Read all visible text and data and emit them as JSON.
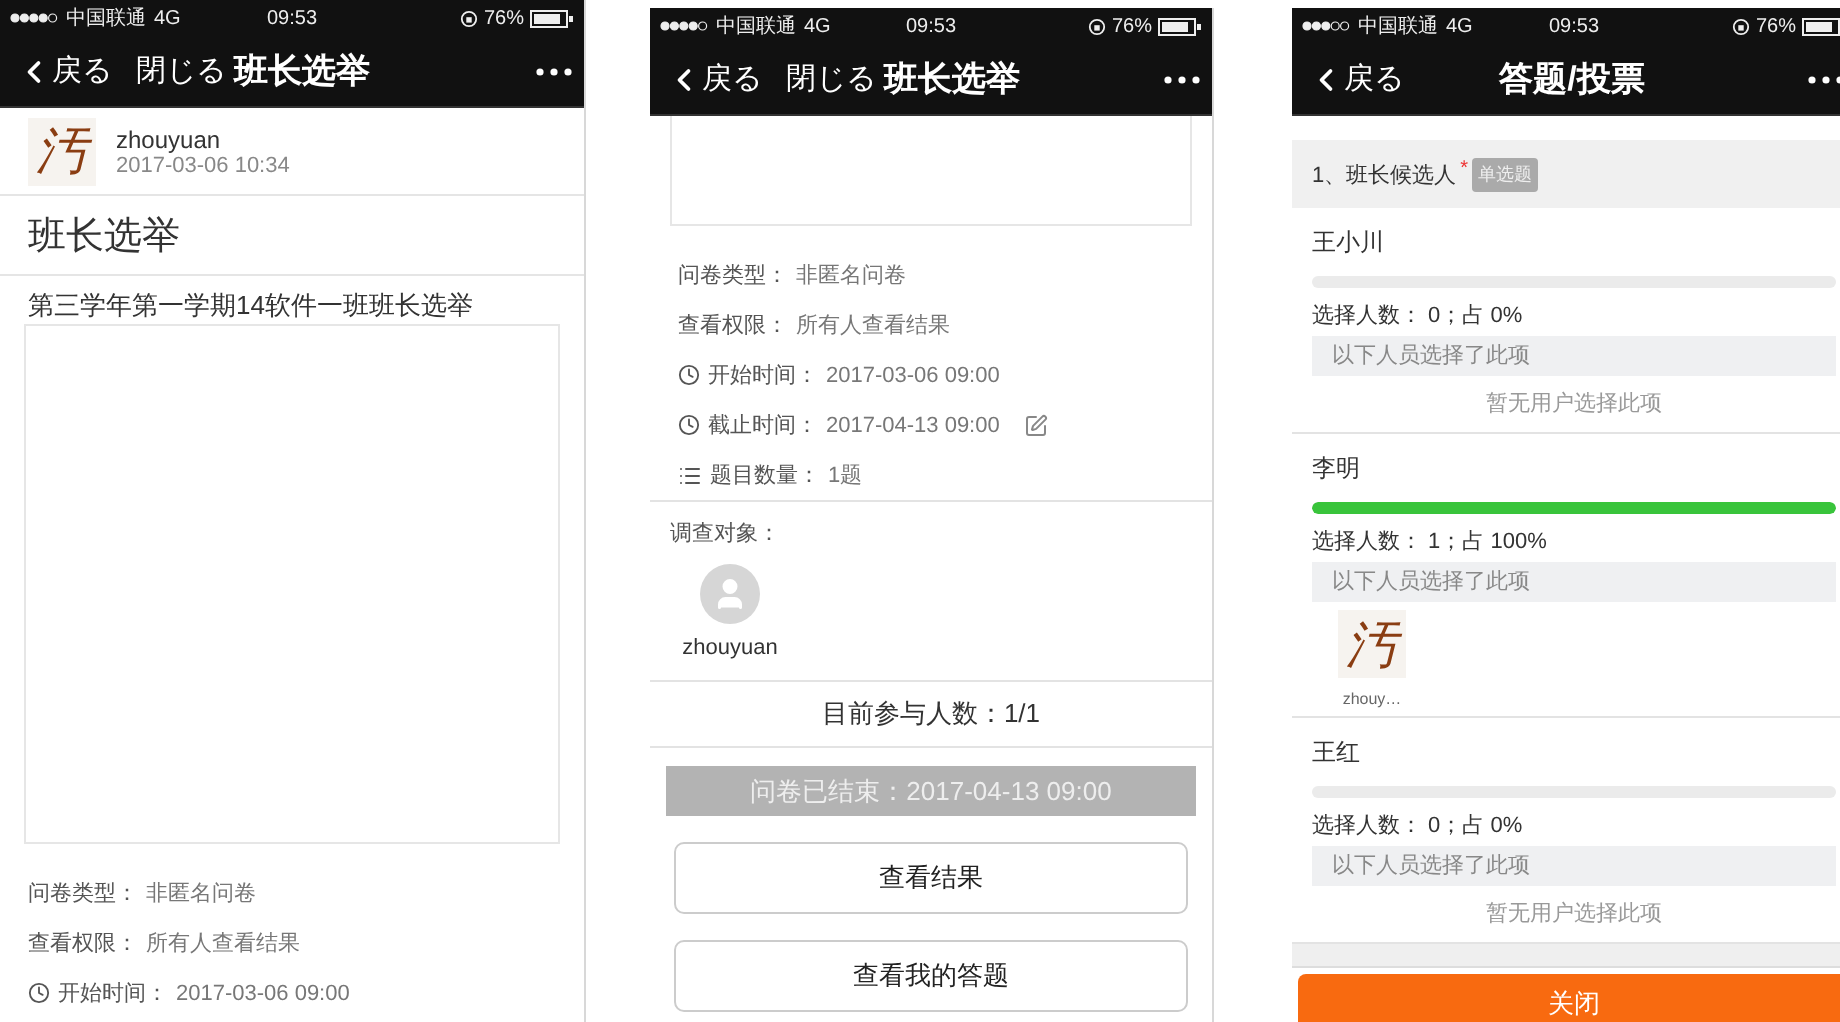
{
  "phones": [
    {
      "kind": "detail",
      "status": {
        "carrier": "中国联通",
        "network": "4G",
        "time": "09:53",
        "battery": "76%"
      },
      "nav": {
        "back": "戻る",
        "close": "閉じる",
        "title": "班长选举"
      },
      "author": {
        "avatar": "汚",
        "name": "zhouyuan",
        "date": "2017-03-06 10:34"
      },
      "title": "班长选举",
      "description": "第三学年第一学期14软件一班班长选举",
      "info": [
        {
          "kind": "plain",
          "label": "问卷类型：",
          "value": "非匿名问卷",
          "editable": false
        },
        {
          "kind": "plain",
          "label": "查看权限：",
          "value": "所有人查看结果",
          "editable": false
        },
        {
          "kind": "clock",
          "label": "开始时间：",
          "value": "2017-03-06 09:00",
          "editable": false
        }
      ]
    },
    {
      "kind": "detail",
      "status": {
        "carrier": "中国联通",
        "network": "4G",
        "time": "09:53",
        "battery": "76%"
      },
      "nav": {
        "back": "戻る",
        "close": "閉じる",
        "title": "班长选举"
      },
      "info": [
        {
          "kind": "plain",
          "label": "问卷类型：",
          "value": "非匿名问卷",
          "editable": false
        },
        {
          "kind": "plain",
          "label": "查看权限：",
          "value": "所有人查看结果",
          "editable": false
        },
        {
          "kind": "clock",
          "label": "开始时间：",
          "value": "2017-03-06 09:00",
          "editable": false
        },
        {
          "kind": "clock",
          "label": "截止时间：",
          "value": "2017-04-13 09:00",
          "editable": true
        },
        {
          "kind": "list",
          "label": "题目数量：",
          "value": "1题",
          "editable": false
        }
      ],
      "targets": {
        "label": "调查对象：",
        "people": [
          {
            "name": "zhouyuan"
          }
        ]
      },
      "participants": "目前参与人数：1/1",
      "ended_banner": "问卷已结束：2017-04-13 09:00",
      "buttons": [
        "查看结果",
        "查看我的答题"
      ]
    },
    {
      "kind": "results",
      "status": {
        "carrier": "中国联通",
        "network": "4G",
        "time": "09:53",
        "battery": "76%"
      },
      "nav": {
        "back": "戻る",
        "title": "答题/投票"
      },
      "question": {
        "text": "1、班长候选人",
        "required_mark": "*",
        "tag": "单选题"
      },
      "options": [
        {
          "name": "王小川",
          "level": 0,
          "stats": "选择人数： 0；占 0%",
          "voters_label": "以下人员选择了此项",
          "empty": "暂无用户选择此项"
        },
        {
          "name": "李明",
          "level": 1,
          "stats": "选择人数： 1；占 100%",
          "voters_label": "以下人员选择了此项",
          "voters": [
            {
              "avatar": "汚",
              "name": "zhouy…"
            }
          ]
        },
        {
          "name": "王红",
          "level": 0,
          "stats": "选择人数： 0；占 0%",
          "voters_label": "以下人员选择了此项",
          "empty": "暂无用户选择此项"
        }
      ],
      "close_button": "关闭"
    }
  ]
}
